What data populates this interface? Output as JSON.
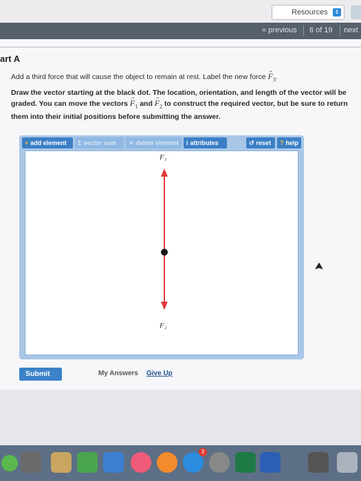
{
  "header": {
    "resources_label": "Resources",
    "nav_previous": "« previous",
    "nav_count": "6 of 19",
    "nav_next": "next"
  },
  "part": {
    "title": "art A",
    "line1_text": "Add a third force that will cause the object to remain at rest. Label the new force",
    "new_force_symbol": "F",
    "new_force_sub": "3",
    "line2_a": "Draw the vector starting at the black dot. The location, orientation, and length of the vector will be graded. You can move the vectors",
    "f1_symbol": "F",
    "f1_sub": "1",
    "and_text": "and",
    "f2_symbol": "F",
    "f2_sub": "2",
    "line2_b": "to construct the required vector, but be sure to return them into their initial positions before submitting the answer."
  },
  "toolbar": {
    "add_element": "add element",
    "vector_sum": "vector sum",
    "delete_element": "delete element",
    "attributes": "attributes",
    "reset": "reset",
    "help": "help"
  },
  "canvas": {
    "f1_label": "F₁",
    "f2_label": "F₂",
    "vector_color": "#e23a3a"
  },
  "actions": {
    "submit": "Submit",
    "my_answers": "My Answers",
    "give_up": "Give Up"
  },
  "dock": {
    "badge": "3",
    "icons": [
      "messages-icon",
      "preview-icon",
      "numbers-icon",
      "keynote-icon",
      "itunes-icon",
      "ibooks-icon",
      "app-store-icon",
      "system-preferences-icon",
      "excel-icon",
      "word-icon",
      "finder-window-icon",
      "trash-icon"
    ]
  }
}
